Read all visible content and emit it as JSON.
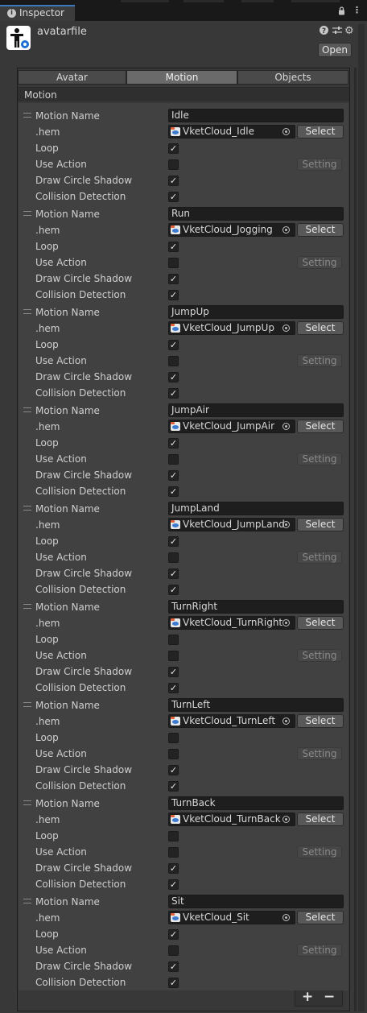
{
  "window": {
    "tab_title": "Inspector",
    "tab_icon": "info-icon",
    "toolbar_icons": [
      "lock-icon",
      "menu-icon"
    ]
  },
  "header": {
    "asset_name": "avatarfile",
    "asset_icon": "avatar-person-icon",
    "header_icons": [
      "help-icon",
      "preset-icon",
      "gear-icon"
    ],
    "open_label": "Open"
  },
  "tabs": [
    {
      "label": "Avatar",
      "active": false
    },
    {
      "label": "Motion",
      "active": true
    },
    {
      "label": "Objects",
      "active": false
    }
  ],
  "section": {
    "title": "Motion"
  },
  "labels": {
    "motion_name": "Motion Name",
    "hem": ".hem",
    "loop": "Loop",
    "use_action": "Use Action",
    "draw_circle_shadow": "Draw Circle Shadow",
    "collision_detection": "Collision Detection",
    "select": "Select",
    "setting": "Setting"
  },
  "motions": [
    {
      "name": "Idle",
      "hem": "VketCloud_Idle",
      "loop": true,
      "use_action": false,
      "draw_circle_shadow": true,
      "collision_detection": true
    },
    {
      "name": "Run",
      "hem": "VketCloud_Jogging",
      "loop": true,
      "use_action": false,
      "draw_circle_shadow": true,
      "collision_detection": true
    },
    {
      "name": "JumpUp",
      "hem": "VketCloud_JumpUp",
      "loop": true,
      "use_action": false,
      "draw_circle_shadow": true,
      "collision_detection": true
    },
    {
      "name": "JumpAir",
      "hem": "VketCloud_JumpAir",
      "loop": true,
      "use_action": false,
      "draw_circle_shadow": true,
      "collision_detection": true
    },
    {
      "name": "JumpLand",
      "hem": "VketCloud_JumpLand",
      "loop": true,
      "use_action": false,
      "draw_circle_shadow": true,
      "collision_detection": true
    },
    {
      "name": "TurnRight",
      "hem": "VketCloud_TurnRight",
      "loop": false,
      "use_action": false,
      "draw_circle_shadow": true,
      "collision_detection": true
    },
    {
      "name": "TurnLeft",
      "hem": "VketCloud_TurnLeft",
      "loop": false,
      "use_action": false,
      "draw_circle_shadow": true,
      "collision_detection": true
    },
    {
      "name": "TurnBack",
      "hem": "VketCloud_TurnBack",
      "loop": false,
      "use_action": false,
      "draw_circle_shadow": true,
      "collision_detection": true
    },
    {
      "name": "Sit",
      "hem": "VketCloud_Sit",
      "loop": true,
      "use_action": false,
      "draw_circle_shadow": true,
      "collision_detection": true
    }
  ],
  "list_footer": {
    "add_icon": "plus-icon",
    "remove_icon": "minus-icon"
  },
  "colors": {
    "accent_tab": "#3a79bb",
    "background": "#383838"
  }
}
